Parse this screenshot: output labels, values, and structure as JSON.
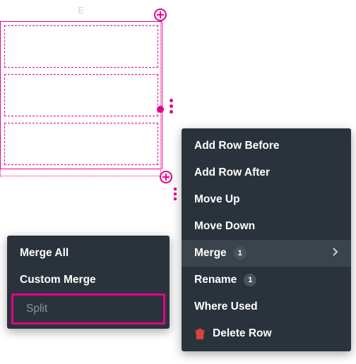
{
  "accentColor": "#e7008a",
  "grid": {
    "columnLabel": "E",
    "cellCount": 3
  },
  "primaryMenu": {
    "items": [
      {
        "key": "add_before",
        "label": "Add Row Before"
      },
      {
        "key": "add_after",
        "label": "Add Row After"
      },
      {
        "key": "move_up",
        "label": "Move Up"
      },
      {
        "key": "move_down",
        "label": "Move Down"
      },
      {
        "key": "merge",
        "label": "Merge",
        "badge": "1",
        "submenu": true,
        "hover": true
      },
      {
        "key": "rename",
        "label": "Rename",
        "badge": "1"
      },
      {
        "key": "where_used",
        "label": "Where Used"
      },
      {
        "key": "delete",
        "label": "Delete Row",
        "icon": "trash"
      }
    ]
  },
  "mergeSubmenu": {
    "items": [
      {
        "key": "merge_all",
        "label": "Merge All"
      },
      {
        "key": "custom_merge",
        "label": "Custom Merge"
      },
      {
        "key": "split",
        "label": "Split",
        "disabled": true,
        "highlighted": true
      }
    ]
  }
}
